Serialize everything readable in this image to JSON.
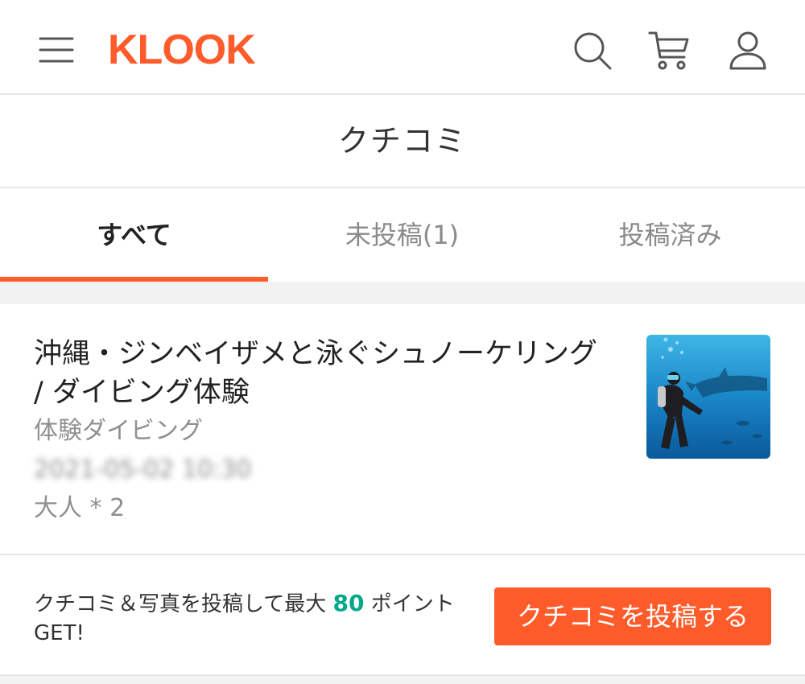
{
  "header": {
    "logo_text": "KLOOK",
    "brand_color": "#ff5b2b",
    "icons": [
      "menu-icon",
      "search-icon",
      "cart-icon",
      "user-icon"
    ]
  },
  "page": {
    "title": "クチコミ"
  },
  "tabs": [
    {
      "label": "すべて",
      "active": true
    },
    {
      "label": "未投稿(1)",
      "active": false
    },
    {
      "label": "投稿済み",
      "active": false
    }
  ],
  "review_card": {
    "activity_title": "沖縄・ジンベイザメと泳ぐシュノーケリング / ダイビング体験",
    "package_name": "体験ダイビング",
    "booking_date": "2021-05-02 10:30",
    "quantity": "大人 * 2"
  },
  "promo": {
    "text_before": "クチコミ＆写真を投稿して最大 ",
    "points": "80",
    "text_after": " ポイントGET!",
    "points_color": "#00a88a"
  },
  "actions": {
    "post_review_label": "クチコミを投稿する"
  }
}
